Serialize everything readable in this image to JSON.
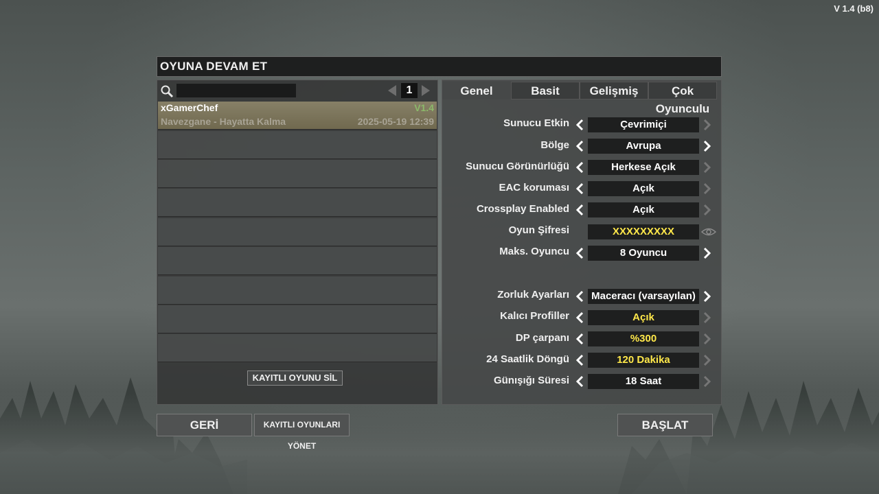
{
  "version": "V 1.4 (b8)",
  "title": "OYUNA DEVAM ET",
  "saves_panel": {
    "search_placeholder": "",
    "page": "1",
    "saves": [
      {
        "name": "xGamerChef",
        "version": "V1.4",
        "world": "Navezgane - Hayatta Kalma",
        "date": "2025-05-19 12:39"
      }
    ],
    "delete_label": "KAYITLI OYUNU SİL"
  },
  "settings_panel": {
    "tabs": [
      "Genel",
      "Basit",
      "Gelişmiş",
      "Çok Oyunculu"
    ],
    "active_tab": "Genel",
    "settings": [
      {
        "label": "Sunucu Etkin",
        "value": "Çevrimiçi"
      },
      {
        "label": "Bölge",
        "value": "Avrupa"
      },
      {
        "label": "Sunucu Görünürlüğü",
        "value": "Herkese Açık"
      },
      {
        "label": "EAC koruması",
        "value": "Açık"
      },
      {
        "label": "Crossplay Enabled",
        "value": "Açık"
      },
      {
        "label": "Oyun Şifresi",
        "value": "XXXXXXXXX"
      },
      {
        "label": "Maks. Oyuncu",
        "value": "8 Oyuncu"
      },
      {
        "label": "Zorluk Ayarları",
        "value": "Maceracı (varsayılan)"
      },
      {
        "label": "Kalıcı Profiller",
        "value": "Açık"
      },
      {
        "label": "DP çarpanı",
        "value": "%300"
      },
      {
        "label": "24 Saatlik Döngü",
        "value": "120 Dakika"
      },
      {
        "label": "Günışığı Süresi",
        "value": "18 Saat"
      }
    ]
  },
  "buttons": {
    "back": "GERİ",
    "manage": "KAYITLI OYUNLARI YÖNET",
    "start": "BAŞLAT"
  },
  "colors": {
    "highlight_value": "#ffe84a",
    "version_green": "#8cb96a",
    "selected_row": "#7c755b"
  },
  "icons": [
    "search-icon",
    "chevron-left-icon",
    "chevron-right-icon",
    "eye-icon"
  ]
}
